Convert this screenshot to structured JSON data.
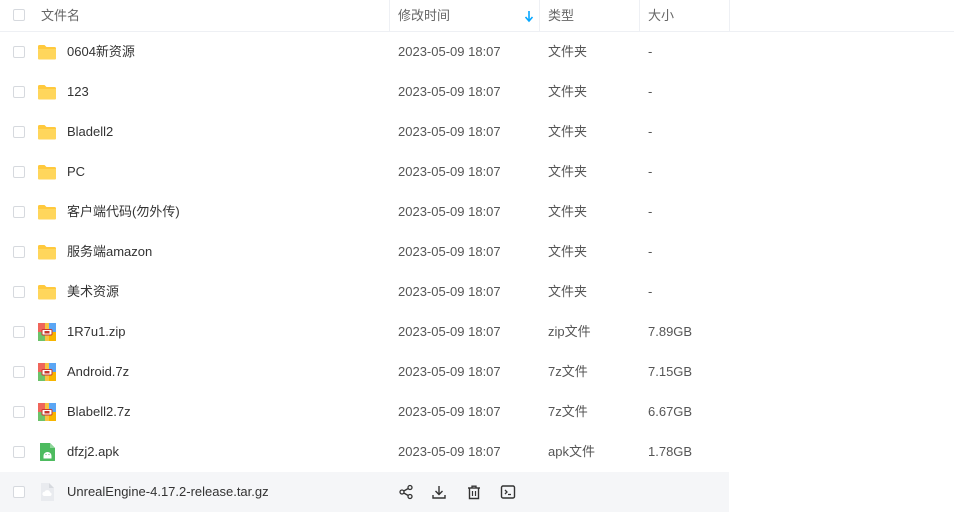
{
  "header": {
    "name": "文件名",
    "modified": "修改时间",
    "type": "类型",
    "size": "大小"
  },
  "colors": {
    "folder": "#FFC93D",
    "accent": "#06A7FF"
  },
  "files": [
    {
      "name": "0604新资源",
      "modified": "2023-05-09 18:07",
      "type": "文件夹",
      "size": "-",
      "icon": "folder-icon"
    },
    {
      "name": "123",
      "modified": "2023-05-09 18:07",
      "type": "文件夹",
      "size": "-",
      "icon": "folder-icon"
    },
    {
      "name": "Bladell2",
      "modified": "2023-05-09 18:07",
      "type": "文件夹",
      "size": "-",
      "icon": "folder-icon"
    },
    {
      "name": "PC",
      "modified": "2023-05-09 18:07",
      "type": "文件夹",
      "size": "-",
      "icon": "folder-icon"
    },
    {
      "name": "客户端代码(勿外传)",
      "modified": "2023-05-09 18:07",
      "type": "文件夹",
      "size": "-",
      "icon": "folder-icon"
    },
    {
      "name": "服务端amazon",
      "modified": "2023-05-09 18:07",
      "type": "文件夹",
      "size": "-",
      "icon": "folder-icon"
    },
    {
      "name": "美术资源",
      "modified": "2023-05-09 18:07",
      "type": "文件夹",
      "size": "-",
      "icon": "folder-icon"
    },
    {
      "name": "1R7u1.zip",
      "modified": "2023-05-09 18:07",
      "type": "zip文件",
      "size": "7.89GB",
      "icon": "archive-icon"
    },
    {
      "name": "Android.7z",
      "modified": "2023-05-09 18:07",
      "type": "7z文件",
      "size": "7.15GB",
      "icon": "archive-icon"
    },
    {
      "name": "Blabell2.7z",
      "modified": "2023-05-09 18:07",
      "type": "7z文件",
      "size": "6.67GB",
      "icon": "archive-icon"
    },
    {
      "name": "dfzj2.apk",
      "modified": "2023-05-09 18:07",
      "type": "apk文件",
      "size": "1.78GB",
      "icon": "apk-icon"
    }
  ],
  "hover_row": {
    "name": "UnrealEngine-4.17.2-release.tar.gz",
    "icon": "cloud-file-icon"
  }
}
